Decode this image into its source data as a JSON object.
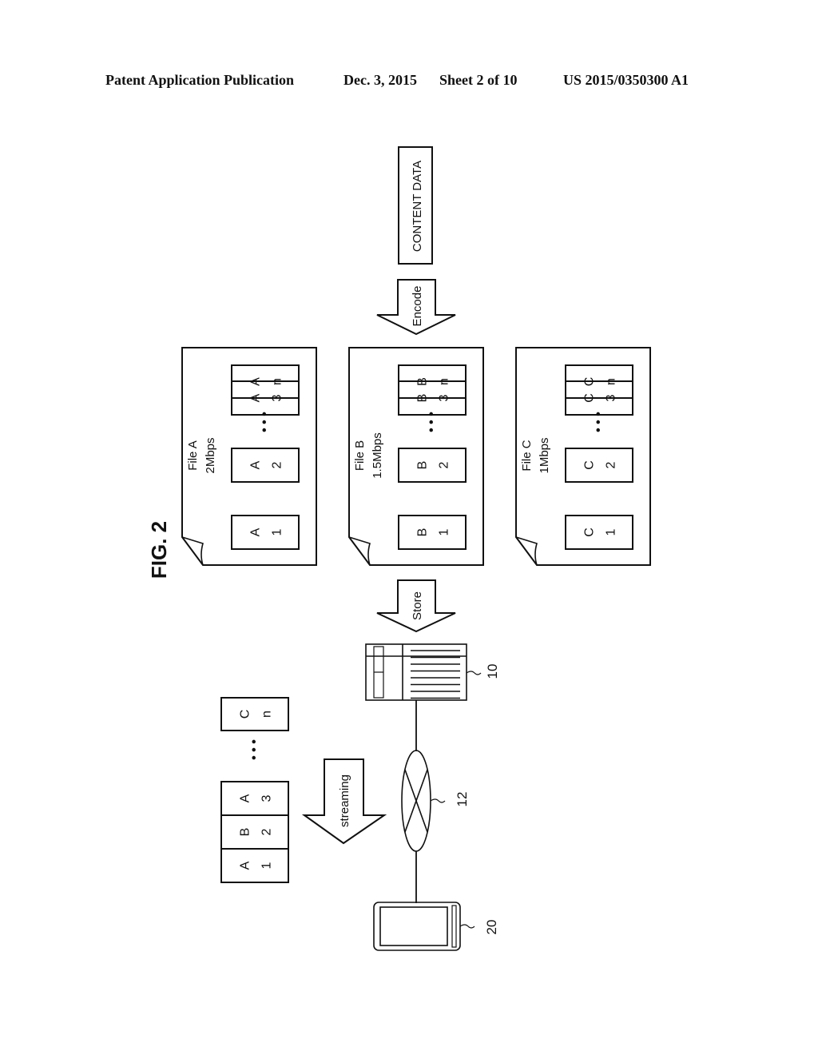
{
  "header": {
    "publication": "Patent Application Publication",
    "date": "Dec. 3, 2015",
    "sheet": "Sheet 2 of 10",
    "number": "US 2015/0350300 A1"
  },
  "figure": {
    "title": "FIG. 2",
    "content_data": "CONTENT DATA",
    "arrows": {
      "encode": "Encode",
      "store": "Store",
      "streaming": "streaming"
    },
    "files": [
      {
        "name": "File A",
        "bitrate": "2Mbps",
        "segments": [
          {
            "id": "A",
            "num": "1"
          },
          {
            "id": "A",
            "num": "2"
          },
          {
            "id": "A",
            "num": "3"
          }
        ],
        "last": {
          "id": "A",
          "num": "n"
        }
      },
      {
        "name": "File B",
        "bitrate": "1.5Mbps",
        "segments": [
          {
            "id": "B",
            "num": "1"
          },
          {
            "id": "B",
            "num": "2"
          },
          {
            "id": "B",
            "num": "3"
          }
        ],
        "last": {
          "id": "B",
          "num": "n"
        }
      },
      {
        "name": "File C",
        "bitrate": "1Mbps",
        "segments": [
          {
            "id": "C",
            "num": "1"
          },
          {
            "id": "C",
            "num": "2"
          },
          {
            "id": "C",
            "num": "3"
          }
        ],
        "last": {
          "id": "C",
          "num": "n"
        }
      }
    ],
    "stream": {
      "segments": [
        {
          "id": "A",
          "num": "1"
        },
        {
          "id": "B",
          "num": "2"
        },
        {
          "id": "A",
          "num": "3"
        }
      ],
      "last": {
        "id": "C",
        "num": "n"
      }
    },
    "ellipsis": "• • •",
    "refs": {
      "server": "10",
      "network": "12",
      "terminal": "20"
    }
  }
}
